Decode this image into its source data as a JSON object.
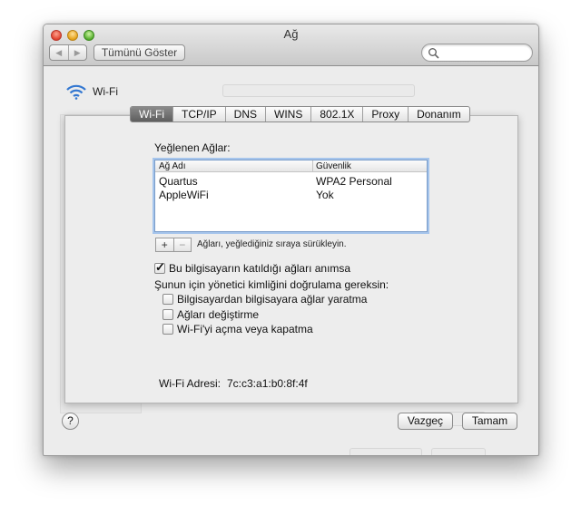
{
  "window": {
    "title": "Ağ"
  },
  "toolbar": {
    "show_all": "Tümünü Göster",
    "back_glyph": "◀",
    "forward_glyph": "▶"
  },
  "pane": {
    "interface_label": "Wi-Fi"
  },
  "tabs": [
    "Wi-Fi",
    "TCP/IP",
    "DNS",
    "WINS",
    "802.1X",
    "Proxy",
    "Donanım"
  ],
  "preferred": {
    "heading": "Yeğlenen Ağlar:",
    "columns": [
      "Ağ Adı",
      "Güvenlik"
    ],
    "networks": [
      {
        "name": "Quartus",
        "security": "WPA2 Personal"
      },
      {
        "name": "AppleWiFi",
        "security": "Yok"
      }
    ],
    "add_label": "+",
    "remove_label": "−",
    "hint": "Ağları, yeğlediğiniz sıraya sürükleyin."
  },
  "options": {
    "remember": {
      "label": "Bu bilgisayarın katıldığı ağları anımsa",
      "checked": true
    },
    "admin_heading": "Şunun için yönetici kimliğini doğrulama gereksin:",
    "items": [
      {
        "label": "Bilgisayardan bilgisayara ağlar yaratma",
        "checked": false
      },
      {
        "label": "Ağları değiştirme",
        "checked": false
      },
      {
        "label": "Wi-Fi'yi açma veya kapatma",
        "checked": false
      }
    ]
  },
  "address": {
    "label": "Wi-Fi Adresi:",
    "value": "7c:c3:a1:b0:8f:4f"
  },
  "buttons": {
    "help": "?",
    "cancel": "Vazgeç",
    "ok": "Tamam"
  },
  "colors": {
    "accent": "#3478d1",
    "active_tab": "#6a6a6a"
  }
}
